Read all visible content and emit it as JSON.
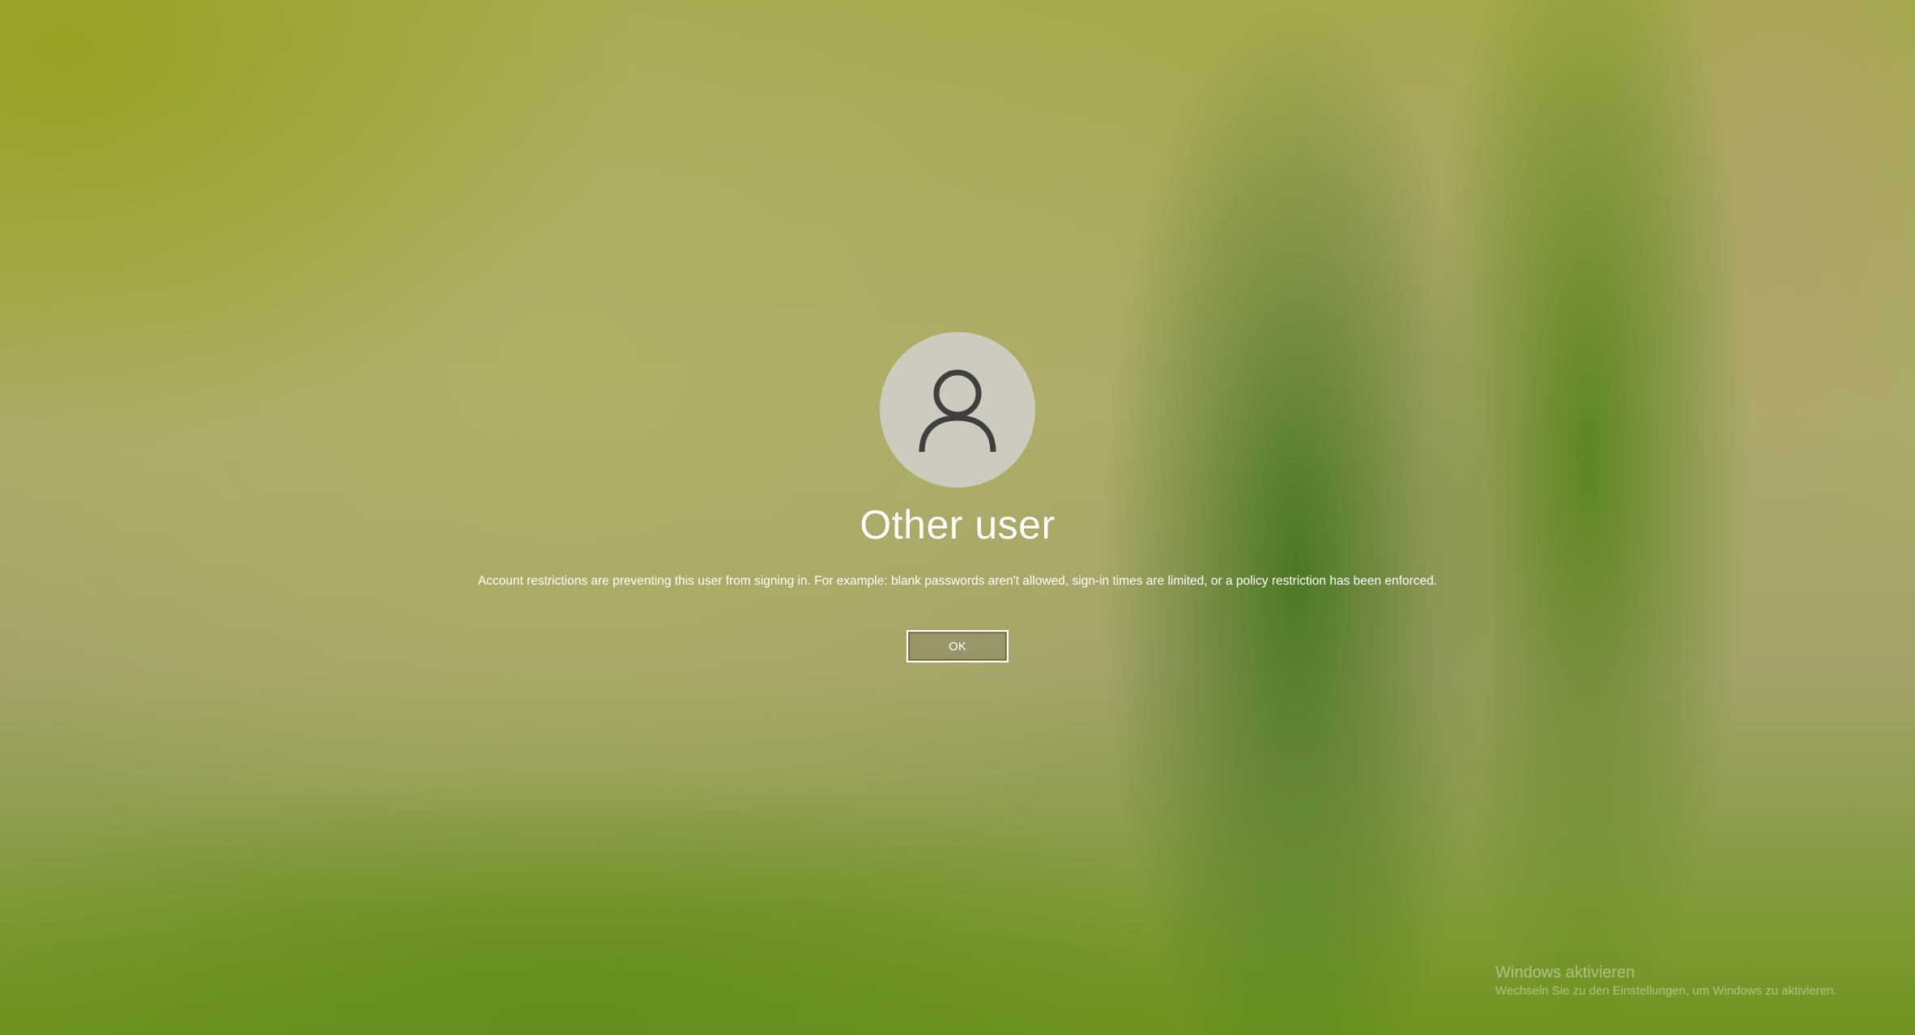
{
  "screen": {
    "type": "windows-sign-in",
    "background": "blurred green leaves"
  },
  "account": {
    "avatar_icon": "person-icon",
    "user_name": "Other user"
  },
  "error": {
    "message": "Account restrictions are preventing this user from signing in. For example: blank passwords aren't allowed, sign-in times are limited, or a policy restriction has been enforced."
  },
  "actions": {
    "ok_label": "OK"
  },
  "activation_watermark": {
    "title": "Windows aktivieren",
    "subtitle": "Wechseln Sie zu den Einstellungen, um Windows zu aktivieren."
  },
  "colors": {
    "avatar_background": "#cdcbbd",
    "icon_stroke": "#3f3f3f",
    "text": "#ffffff"
  }
}
